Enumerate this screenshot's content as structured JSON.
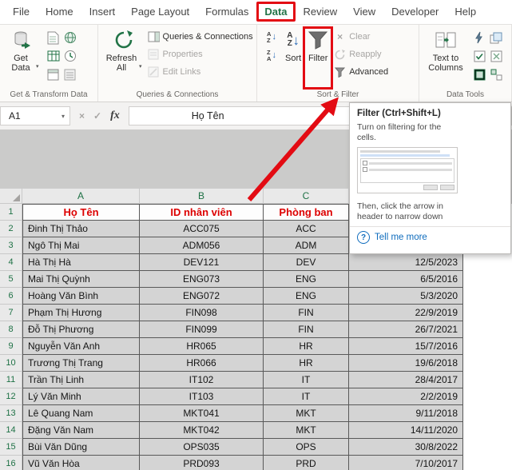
{
  "ribbon_tabs": [
    {
      "label": "File",
      "active": false
    },
    {
      "label": "Home",
      "active": false
    },
    {
      "label": "Insert",
      "active": false
    },
    {
      "label": "Page Layout",
      "active": false
    },
    {
      "label": "Formulas",
      "active": false
    },
    {
      "label": "Data",
      "active": true
    },
    {
      "label": "Review",
      "active": false
    },
    {
      "label": "View",
      "active": false
    },
    {
      "label": "Developer",
      "active": false
    },
    {
      "label": "Help",
      "active": false
    }
  ],
  "ribbon": {
    "groups": [
      "Get & Transform Data",
      "Queries & Connections",
      "Sort & Filter",
      "Data Tools"
    ],
    "get_data": "Get Data",
    "refresh_all": "Refresh All",
    "queries_connections": "Queries & Connections",
    "properties": "Properties",
    "edit_links": "Edit Links",
    "sort": "Sort",
    "filter": "Filter",
    "clear": "Clear",
    "reapply": "Reapply",
    "advanced": "Advanced",
    "text_to_columns": "Text to Columns"
  },
  "glyphs": {
    "caret": "▾",
    "cancel": "×",
    "enter": "✓",
    "fx": "fx",
    "question": "?",
    "sort_down_arrow": "↓",
    "letter_a": "A",
    "letter_z": "Z"
  },
  "icons": {
    "get-data-icon": "database-cylinder-with-green-arrow",
    "refresh-icon": "green-circular-arrow",
    "filter-icon": "gray-funnel",
    "sort-ascending-icon": "AZ-down-arrow",
    "sort-descending-icon": "ZA-down-arrow",
    "question-icon": "question-mark-in-blue-circle"
  },
  "formula_bar": {
    "name_box": "A1",
    "content": "Họ Tên"
  },
  "tooltip": {
    "title": "Filter (Ctrl+Shift+L)",
    "lines": [
      "Turn on filtering for the",
      "cells.",
      "Then, click the arrow in",
      "header to narrow down"
    ],
    "link": "Tell me more"
  },
  "sheet": {
    "column_headers": [
      "A",
      "B",
      "C"
    ],
    "rows": [
      {
        "num": "1",
        "a": "Họ Tên",
        "b": "ID nhân viên",
        "c": "Phòng ban",
        "d": ""
      },
      {
        "num": "2",
        "a": "Đinh Thị Thảo",
        "b": "ACC075",
        "c": "ACC",
        "d": ""
      },
      {
        "num": "3",
        "a": "Ngô Thị Mai",
        "b": "ADM056",
        "c": "ADM",
        "d": ""
      },
      {
        "num": "4",
        "a": "Hà Thị Hà",
        "b": "DEV121",
        "c": "DEV",
        "d": "12/5/2023"
      },
      {
        "num": "5",
        "a": "Mai Thị Quỳnh",
        "b": "ENG073",
        "c": "ENG",
        "d": "6/5/2016"
      },
      {
        "num": "6",
        "a": "Hoàng Văn Bình",
        "b": "ENG072",
        "c": "ENG",
        "d": "5/3/2020"
      },
      {
        "num": "7",
        "a": "Phạm Thị Hương",
        "b": "FIN098",
        "c": "FIN",
        "d": "22/9/2019"
      },
      {
        "num": "8",
        "a": "Đỗ Thị Phương",
        "b": "FIN099",
        "c": "FIN",
        "d": "26/7/2021"
      },
      {
        "num": "9",
        "a": "Nguyễn Văn Anh",
        "b": "HR065",
        "c": "HR",
        "d": "15/7/2016"
      },
      {
        "num": "10",
        "a": "Trương Thị Trang",
        "b": "HR066",
        "c": "HR",
        "d": "19/6/2018"
      },
      {
        "num": "11",
        "a": "Trần Thị Linh",
        "b": "IT102",
        "c": "IT",
        "d": "28/4/2017"
      },
      {
        "num": "12",
        "a": "Lý Văn Minh",
        "b": "IT103",
        "c": "IT",
        "d": "2/2/2019"
      },
      {
        "num": "13",
        "a": "Lê Quang Nam",
        "b": "MKT041",
        "c": "MKT",
        "d": "9/11/2018"
      },
      {
        "num": "14",
        "a": "Đặng Văn Nam",
        "b": "MKT042",
        "c": "MKT",
        "d": "14/11/2020"
      },
      {
        "num": "15",
        "a": "Bùi Văn Dũng",
        "b": "OPS035",
        "c": "OPS",
        "d": "30/8/2022"
      },
      {
        "num": "16",
        "a": "Vũ Văn Hòa",
        "b": "PRD093",
        "c": "PRD",
        "d": "7/10/2017"
      }
    ]
  },
  "colors": {
    "excel_green": "#217346",
    "annotation_red": "#e30b13",
    "header_text_red": "#dd0000",
    "link_blue": "#0f6cbd",
    "cell_fill_gray": "#d4d4d4"
  }
}
